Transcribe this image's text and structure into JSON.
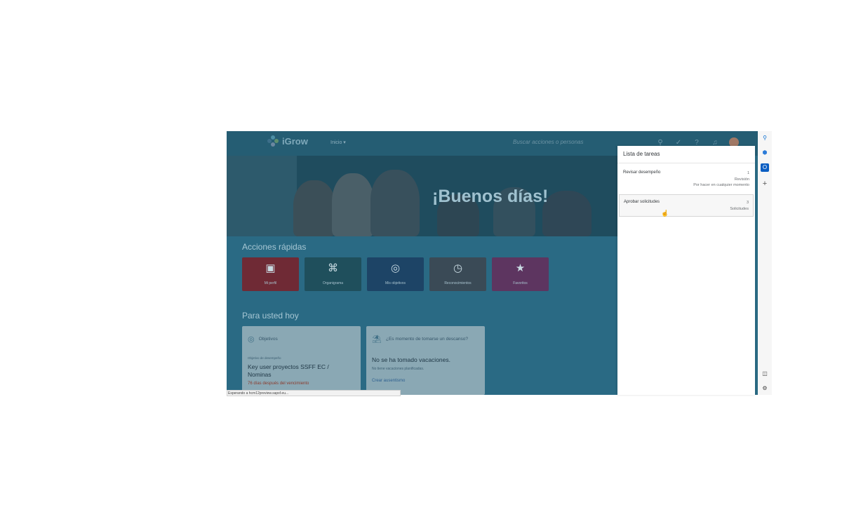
{
  "app": {
    "logo_text": "iGrow",
    "home_menu": "Inicio ▾",
    "search_placeholder": "Buscar acciones o personas",
    "greeting": "¡Buenos días!",
    "quick_actions_title": "Acciones rápidas",
    "today_title": "Para usted hoy",
    "tiles": [
      {
        "label": "Mi perfil",
        "icon": "profile-card-icon",
        "color": "#6f2a35"
      },
      {
        "label": "Organigrama",
        "icon": "org-chart-icon",
        "color": "#1f4f5c"
      },
      {
        "label": "Mis objetivos",
        "icon": "target-icon",
        "color": "#1d4466"
      },
      {
        "label": "Reconocimientos",
        "icon": "recognition-icon",
        "color": "#3a4a56"
      },
      {
        "label": "Favoritos",
        "icon": "star-icon",
        "color": "#5d3560"
      }
    ],
    "cards": {
      "objectives": {
        "title": "Objetivos",
        "subtitle": "Objetivo de desempeño",
        "headline": "Key user proyectos SSFF EC / Nominas",
        "due": "76 días después del vencimiento"
      },
      "vacation": {
        "title": "¿Es momento de tomarse un descanso?",
        "headline": "No se ha tomado vacaciones.",
        "text": "No tiene vacaciones planificadas.",
        "link": "Crear ausentismo"
      }
    }
  },
  "status_bar": "Esperando a hcm12preview.sapsf.eu...",
  "task_panel": {
    "title": "Lista de tareas",
    "tasks": [
      {
        "name": "Revisar desempeño",
        "count": "1",
        "type": "Revisión",
        "due": "Por hacer en cualquier momento"
      },
      {
        "name": "Aprobar solicitudes",
        "count": "3",
        "type": "Solicitudes",
        "due": ""
      }
    ]
  },
  "colors": {
    "accent_blue": "#0a6ed1",
    "sidebar_bg": "#f6f6f6",
    "overlay_teal": "#2a6a84"
  }
}
